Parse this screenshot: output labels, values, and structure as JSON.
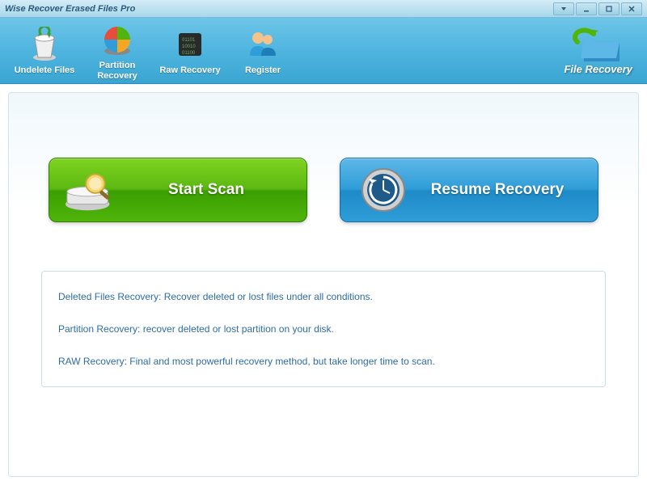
{
  "window": {
    "title": "Wise Recover Erased Files Pro"
  },
  "toolbar": {
    "items": [
      {
        "label": "Undelete Files"
      },
      {
        "label": "Partition\nRecovery"
      },
      {
        "label": "Raw Recovery"
      },
      {
        "label": "Register"
      }
    ],
    "logo": "File Recovery"
  },
  "actions": {
    "scan": "Start  Scan",
    "resume": "Resume Recovery"
  },
  "info": {
    "lines": [
      "Deleted Files Recovery: Recover deleted or lost files  under all conditions.",
      "Partition Recovery: recover deleted or lost partition on your disk.",
      "RAW Recovery: Final and most powerful recovery method, but take longer time to scan."
    ]
  }
}
